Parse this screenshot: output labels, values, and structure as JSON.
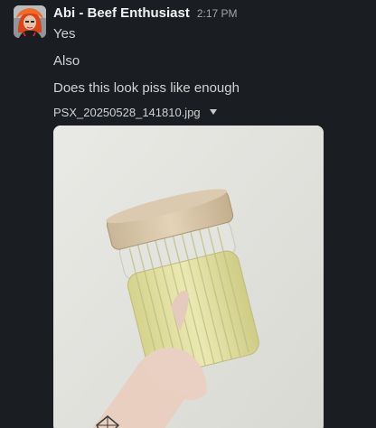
{
  "message": {
    "sender": "Abi - Beef Enthusiast",
    "timestamp": "2:17 PM",
    "lines": [
      "Yes",
      "Also",
      "Does this look piss like enough"
    ],
    "attachment": {
      "file_name": "PSX_20250528_141810.jpg",
      "menu_icon": "caret-down-icon"
    }
  },
  "colors": {
    "background": "#1a1d21",
    "sender_text": "#f2f3f4",
    "body_text": "#d1d2d3",
    "timestamp_text": "#a3a6a9"
  }
}
